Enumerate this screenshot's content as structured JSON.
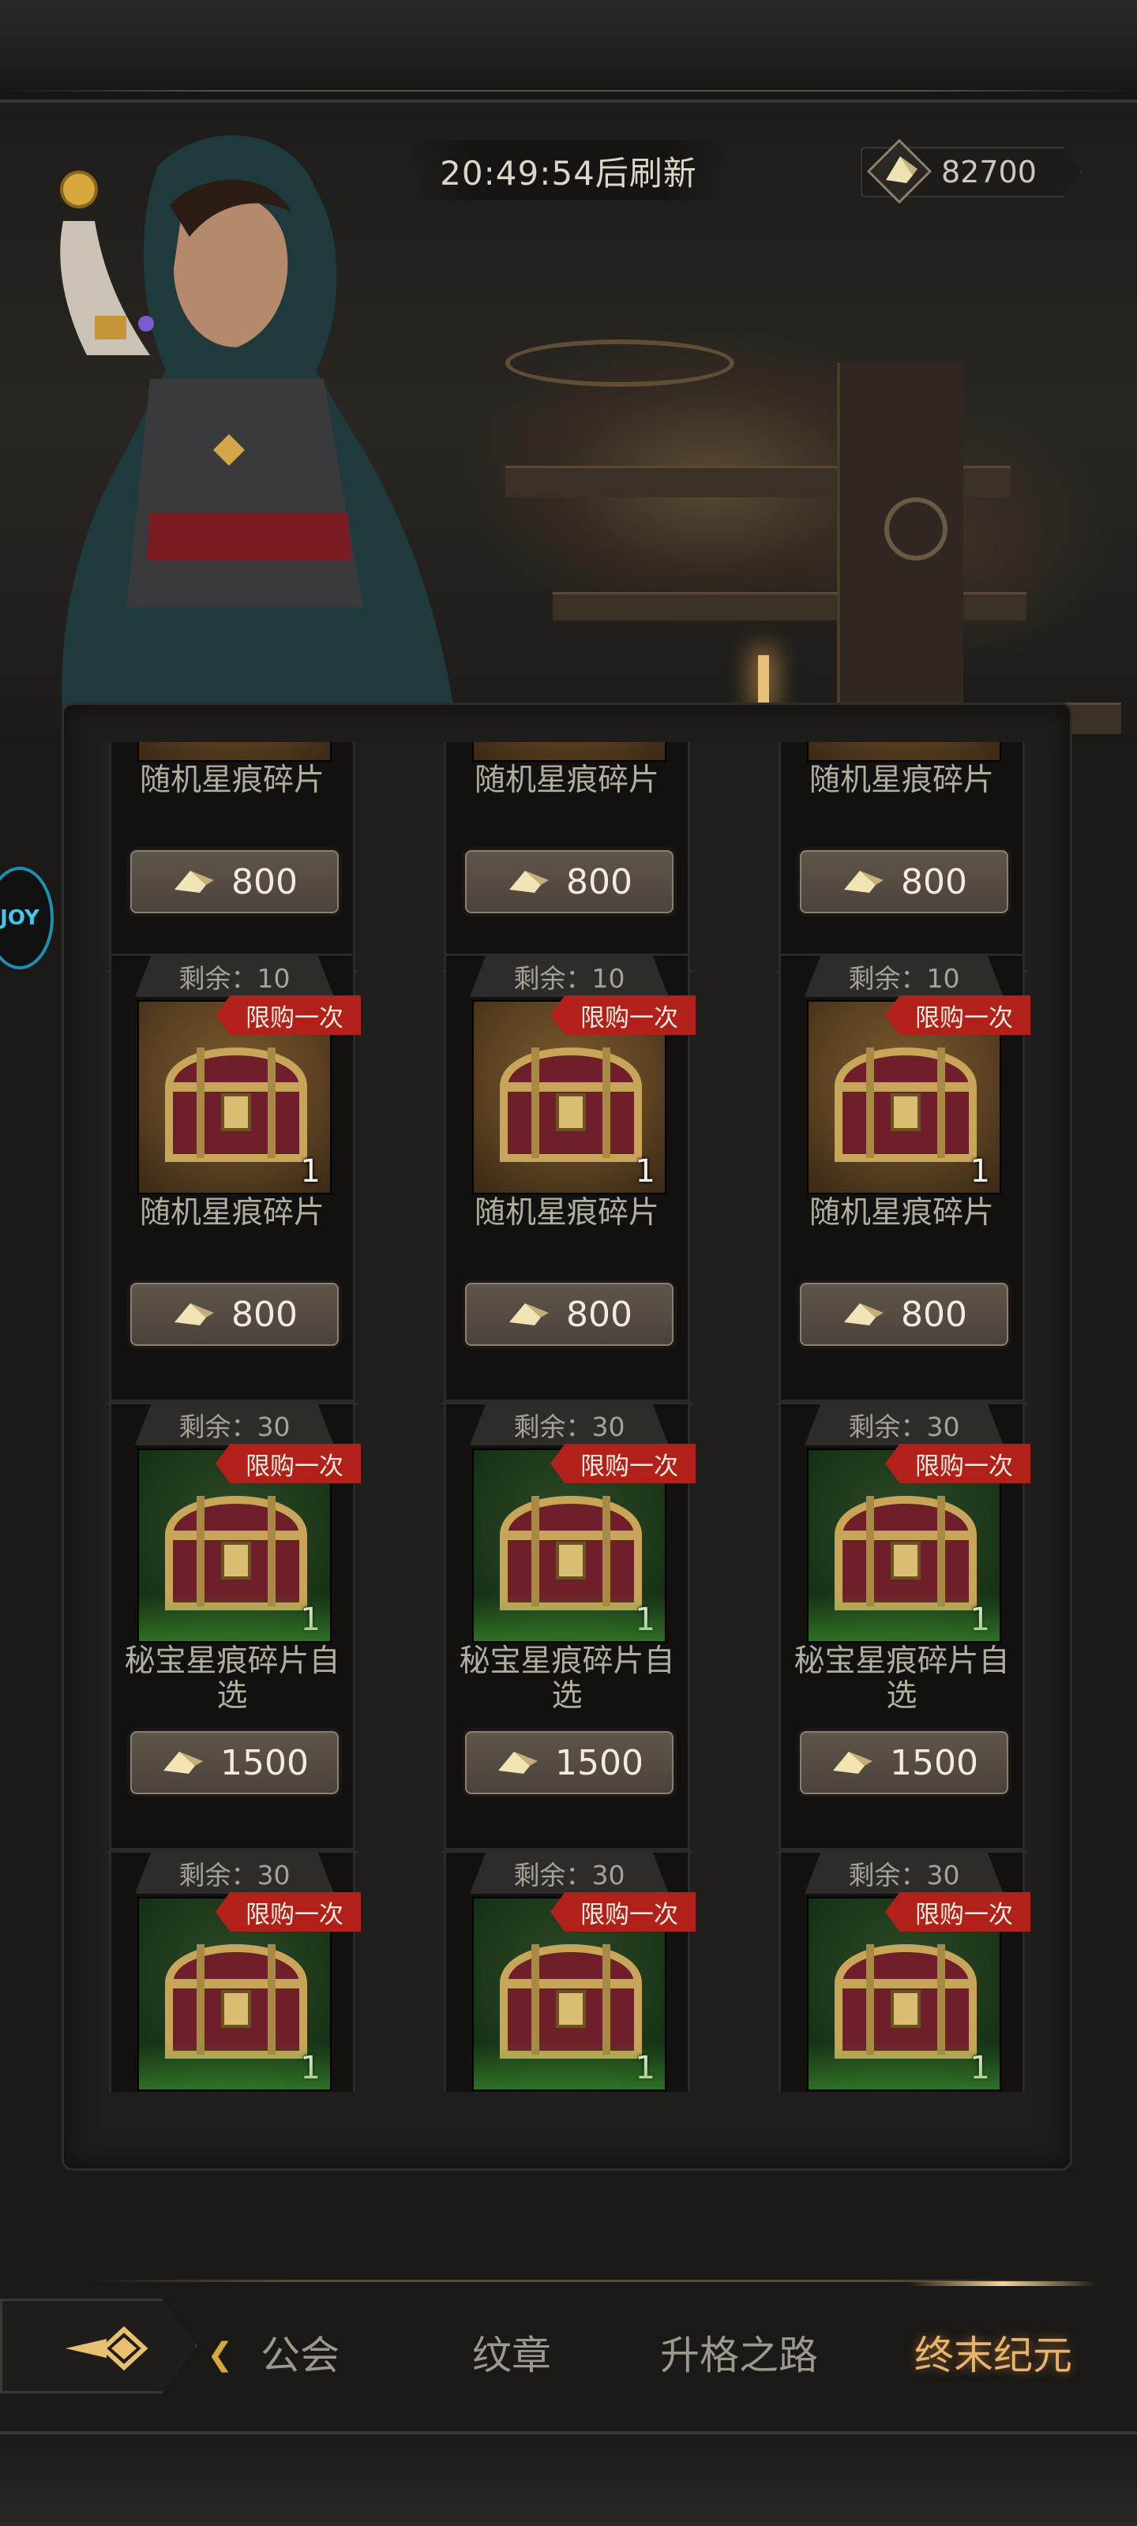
{
  "header": {
    "refresh_timer": "20:49:54后刷新",
    "currency_amount": "82700",
    "currency_icon": "crystal-shard-icon"
  },
  "side_badge": {
    "label": "JOY"
  },
  "cards": [
    {
      "stock": "",
      "limit": "",
      "qty": "",
      "name": "随机星痕碎片",
      "price": "800",
      "bg": "gold"
    },
    {
      "stock": "",
      "limit": "",
      "qty": "",
      "name": "随机星痕碎片",
      "price": "800",
      "bg": "gold"
    },
    {
      "stock": "",
      "limit": "",
      "qty": "",
      "name": "随机星痕碎片",
      "price": "800",
      "bg": "gold"
    },
    {
      "stock": "剩余：10",
      "limit": "限购一次",
      "qty": "1",
      "name": "随机星痕碎片",
      "price": "800",
      "bg": "gold"
    },
    {
      "stock": "剩余：10",
      "limit": "限购一次",
      "qty": "1",
      "name": "随机星痕碎片",
      "price": "800",
      "bg": "gold"
    },
    {
      "stock": "剩余：10",
      "limit": "限购一次",
      "qty": "1",
      "name": "随机星痕碎片",
      "price": "800",
      "bg": "gold"
    },
    {
      "stock": "剩余：30",
      "limit": "限购一次",
      "qty": "1",
      "name": "秘宝星痕碎片自选",
      "price": "1500",
      "bg": "green"
    },
    {
      "stock": "剩余：30",
      "limit": "限购一次",
      "qty": "1",
      "name": "秘宝星痕碎片自选",
      "price": "1500",
      "bg": "green"
    },
    {
      "stock": "剩余：30",
      "limit": "限购一次",
      "qty": "1",
      "name": "秘宝星痕碎片自选",
      "price": "1500",
      "bg": "green"
    },
    {
      "stock": "剩余：30",
      "limit": "限购一次",
      "qty": "1",
      "name": "",
      "price": "",
      "bg": "green"
    },
    {
      "stock": "剩余：30",
      "limit": "限购一次",
      "qty": "1",
      "name": "",
      "price": "",
      "bg": "green"
    },
    {
      "stock": "剩余：30",
      "limit": "限购一次",
      "qty": "1",
      "name": "",
      "price": "",
      "bg": "green"
    }
  ],
  "nav": {
    "tabs": [
      {
        "label": "公会",
        "active": false
      },
      {
        "label": "纹章",
        "active": false
      },
      {
        "label": "升格之路",
        "active": false
      },
      {
        "label": "终末纪元",
        "active": true
      }
    ],
    "back_icon": "diamond-arrow-back-icon"
  },
  "colors": {
    "limit_badge": "#b22119",
    "active_tab": "#e6b46d",
    "inactive_tab": "#9d978c"
  }
}
